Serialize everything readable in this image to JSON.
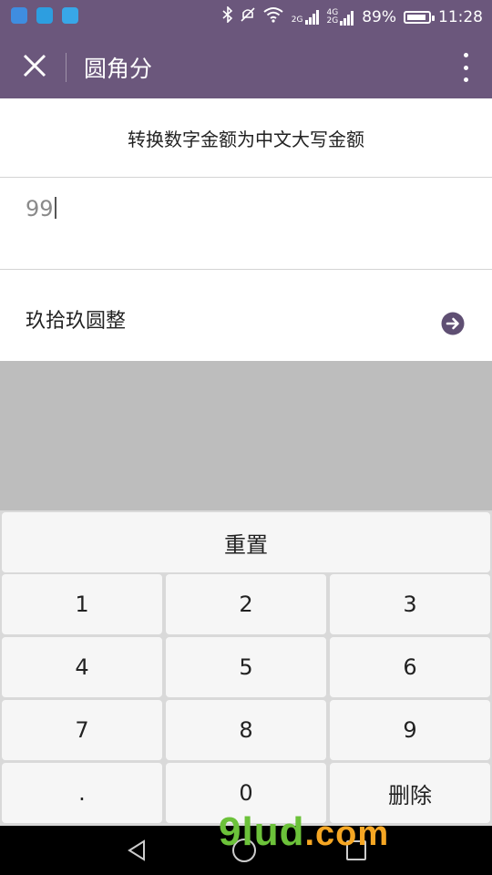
{
  "status_bar": {
    "network_2g": "2G",
    "network_4g": "4G",
    "battery_percent": "89%",
    "battery_level": 0.89,
    "time": "11:28"
  },
  "header": {
    "title": "圆角分",
    "close_icon": "close-icon",
    "more_icon": "more-vert-icon"
  },
  "main": {
    "heading": "转换数字金额为中文大写金额",
    "amount_value": "99",
    "result_text": "玖拾玖圆整",
    "go_icon": "arrow-right-circle-icon"
  },
  "keypad": {
    "reset_label": "重置",
    "keys": [
      "1",
      "2",
      "3",
      "4",
      "5",
      "6",
      "7",
      "8",
      "9",
      ".",
      "0",
      "删除"
    ]
  },
  "watermark": {
    "brand": "9lud",
    "tld": ".com"
  },
  "colors": {
    "header_bg": "#6b577c",
    "keypad_bg": "#d9d9d9",
    "key_bg": "#f6f6f6",
    "page_bg": "#bdbdbd"
  }
}
